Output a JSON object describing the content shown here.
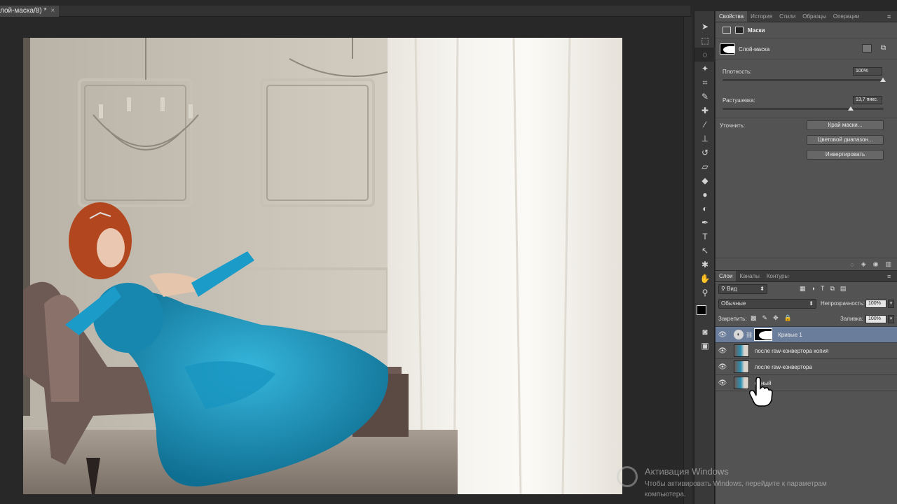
{
  "document": {
    "tab_title": "лой-маска/8) *",
    "close_glyph": "×"
  },
  "toolbar": {
    "tools": [
      {
        "name": "move-tool-icon",
        "glyph": "➤"
      },
      {
        "name": "marquee-tool-icon",
        "glyph": "⬚"
      },
      {
        "name": "lasso-tool-icon",
        "glyph": "◌"
      },
      {
        "name": "magic-wand-icon",
        "glyph": "✦"
      },
      {
        "name": "crop-tool-icon",
        "glyph": "⌗"
      },
      {
        "name": "eyedropper-icon",
        "glyph": "✎"
      },
      {
        "name": "healing-brush-icon",
        "glyph": "✚"
      },
      {
        "name": "brush-tool-icon",
        "glyph": "⁄"
      },
      {
        "name": "clone-stamp-icon",
        "glyph": "⊥"
      },
      {
        "name": "history-brush-icon",
        "glyph": "↺"
      },
      {
        "name": "eraser-tool-icon",
        "glyph": "▱"
      },
      {
        "name": "paint-bucket-icon",
        "glyph": "◆"
      },
      {
        "name": "blur-tool-icon",
        "glyph": "●"
      },
      {
        "name": "dodge-tool-icon",
        "glyph": "◐"
      },
      {
        "name": "pen-tool-icon",
        "glyph": "✒"
      },
      {
        "name": "type-tool-icon",
        "glyph": "T"
      },
      {
        "name": "path-select-icon",
        "glyph": "↖"
      },
      {
        "name": "shape-tool-icon",
        "glyph": "✱"
      },
      {
        "name": "hand-tool-icon",
        "glyph": "✋"
      },
      {
        "name": "zoom-tool-icon",
        "glyph": "⚲"
      }
    ]
  },
  "properties": {
    "tabs": [
      "Свойства",
      "История",
      "Стили",
      "Образцы",
      "Операции"
    ],
    "section_title": "Маски",
    "mask_name": "Слой-маска",
    "density_label": "Плотность:",
    "density_value": "100%",
    "feather_label": "Растушевка:",
    "feather_value": "13,7 пикс.",
    "refine_label": "Уточнить:",
    "btn_mask_edge": "Край маски...",
    "btn_color_range": "Цветовой диапазон...",
    "btn_invert": "Инвертировать"
  },
  "layers": {
    "tabs": [
      "Слои",
      "Каналы",
      "Контуры"
    ],
    "kind_filter": "Вид",
    "blend_mode": "Обычные",
    "opacity_label": "Непрозрачность:",
    "opacity_value": "100%",
    "lock_label": "Закрепить:",
    "fill_label": "Заливка:",
    "fill_value": "100%",
    "rows": [
      {
        "name": "Кривые 1",
        "selected": true
      },
      {
        "name": "после raw-конвертора копия",
        "selected": false
      },
      {
        "name": "после raw-конвертора",
        "selected": false
      },
      {
        "name": "одный",
        "selected": false
      }
    ]
  },
  "watermark": {
    "title": "Активация Windows",
    "line1": "Чтобы активировать Windows, перейдите к параметрам",
    "line2": "компьютера."
  },
  "colors": {
    "selected_layer": "#6a7d9b",
    "dress": "#1a8fb5",
    "panel": "#535353"
  }
}
